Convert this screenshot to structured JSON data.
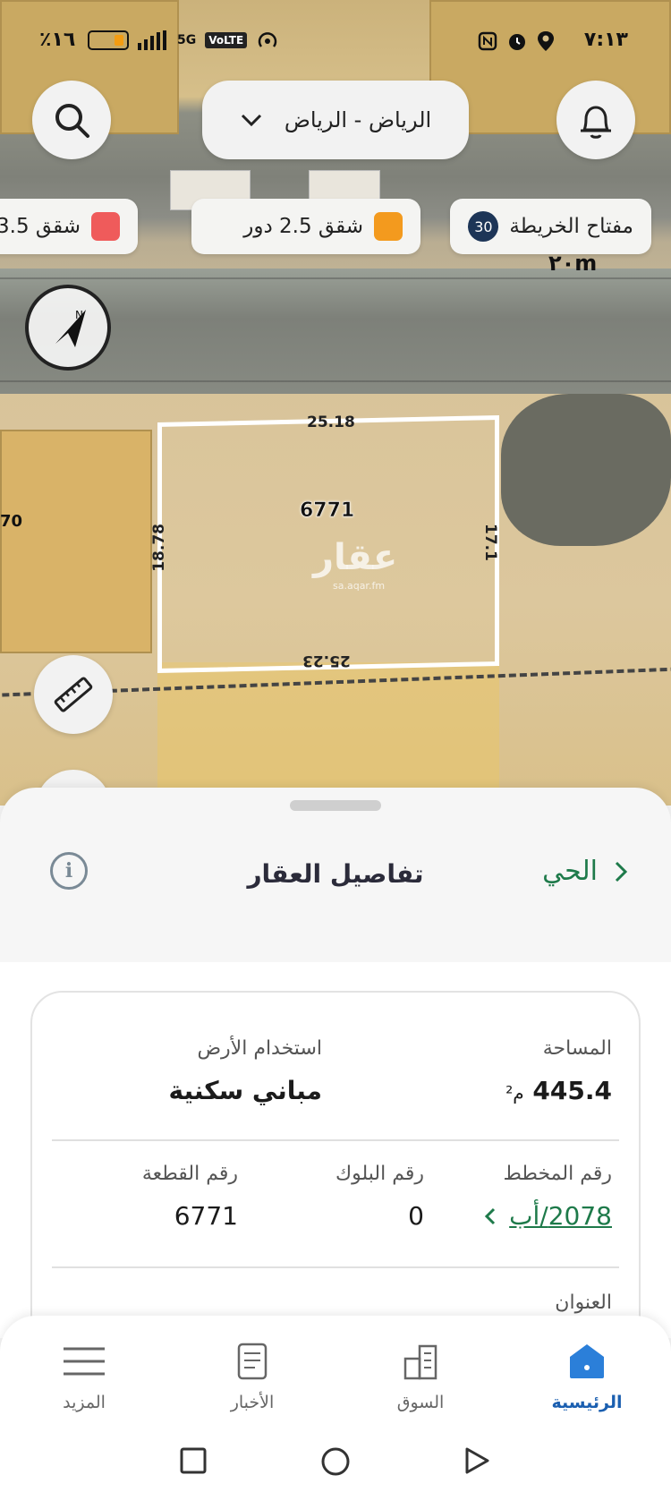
{
  "status_bar": {
    "time": "٧:١٣",
    "battery": "٪١٦",
    "network": "5G",
    "volte": "VoLTE"
  },
  "map": {
    "city_select": "الرياض - الرياض",
    "legend_chips": [
      {
        "label": "مفتاح الخريطة",
        "count": "30"
      },
      {
        "label": "شقق 2.5 دور",
        "color": "#f39a1e"
      },
      {
        "label": "شقق 3.5",
        "color": "#ef5b5b"
      }
    ],
    "scale": "٢٠m",
    "plot": {
      "number": "6771",
      "top_length": "25.18",
      "bottom_length": "25.23",
      "left_length": "18.78",
      "right_length": "17.1"
    },
    "watermark": "عقار",
    "watermark_sub": "sa.aqar.fm",
    "edge_label": "70"
  },
  "sheet": {
    "title": "تفاصيل العقار",
    "back_link": "الحي",
    "info": "i",
    "area": {
      "label": "المساحة",
      "value": "445.4",
      "unit": "م²"
    },
    "land_use": {
      "label": "استخدام الأرض",
      "value": "مباني سكنية"
    },
    "plan_no": {
      "label": "رقم المخطط",
      "value": "2078/أب"
    },
    "block_no": {
      "label": "رقم البلوك",
      "value": "0"
    },
    "plot_no": {
      "label": "رقم القطعة",
      "value": "6771"
    },
    "address": {
      "label": "العنوان"
    }
  },
  "bottom_nav": [
    {
      "label": "الرئيسية",
      "icon": "home-icon",
      "active": true
    },
    {
      "label": "السوق",
      "icon": "buildings-icon"
    },
    {
      "label": "الأخبار",
      "icon": "news-icon"
    },
    {
      "label": "المزيد",
      "icon": "menu-icon"
    }
  ],
  "colors": {
    "accent_green": "#1e7a4a",
    "active_blue": "#1b5fb0"
  }
}
